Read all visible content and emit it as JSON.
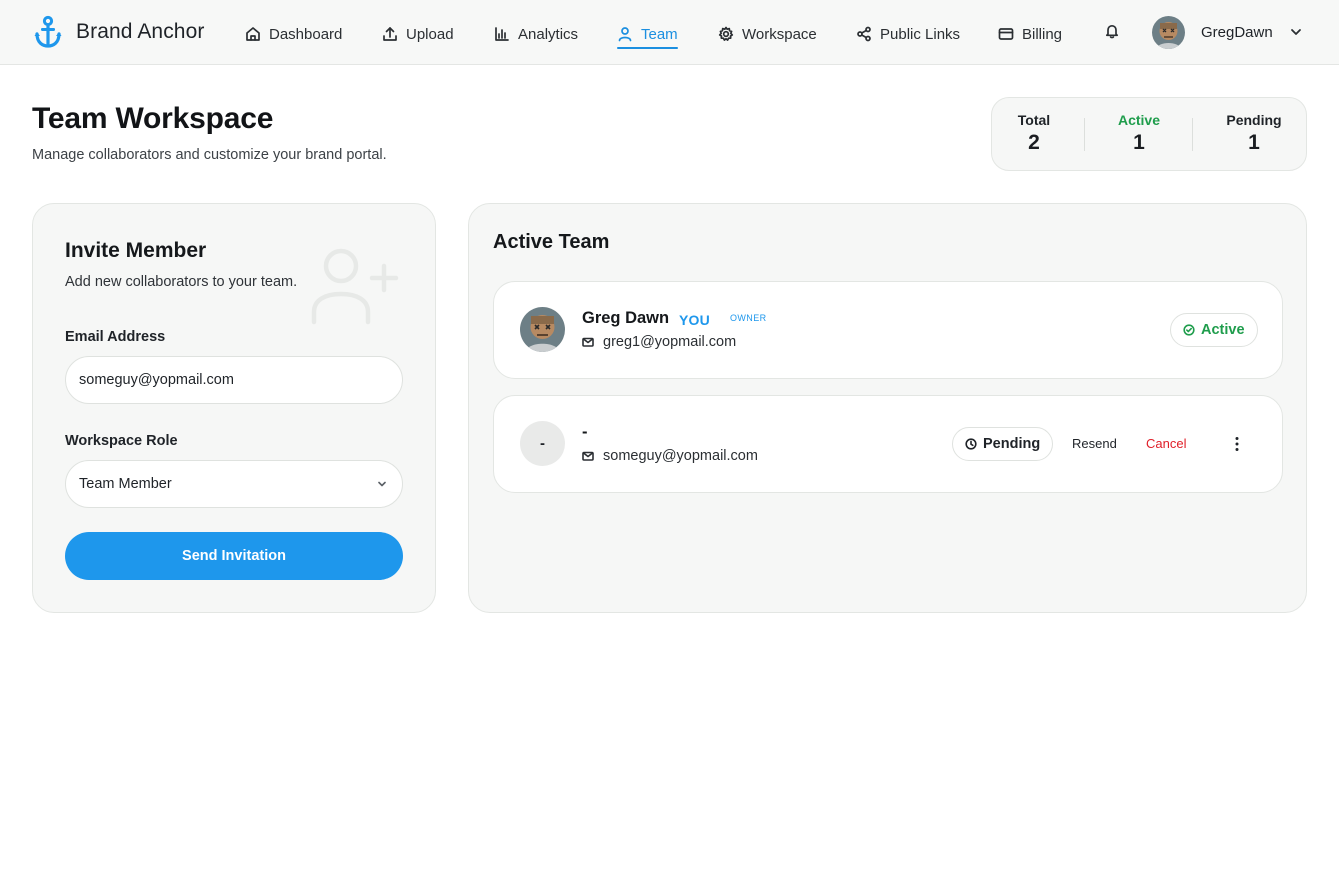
{
  "brand": {
    "name": "Brand Anchor",
    "accent": "#1e97ec"
  },
  "nav": {
    "items": [
      {
        "label": "Dashboard",
        "icon": "home-icon"
      },
      {
        "label": "Upload",
        "icon": "upload-icon"
      },
      {
        "label": "Analytics",
        "icon": "bar-chart-icon"
      },
      {
        "label": "Team",
        "icon": "user-icon",
        "active": true
      },
      {
        "label": "Workspace",
        "icon": "gear-icon"
      },
      {
        "label": "Public Links",
        "icon": "share-icon"
      },
      {
        "label": "Billing",
        "icon": "credit-card-icon"
      }
    ]
  },
  "user": {
    "name": "GregDawn"
  },
  "page": {
    "title": "Team Workspace",
    "subtitle": "Manage collaborators and customize your brand portal."
  },
  "stats": {
    "total_label": "Total",
    "total_value": "2",
    "active_label": "Active",
    "active_value": "1",
    "pending_label": "Pending",
    "pending_value": "1"
  },
  "invite": {
    "title": "Invite Member",
    "subtitle": "Add new collaborators to your team.",
    "email_label": "Email Address",
    "email_value": "someguy@yopmail.com",
    "role_label": "Workspace Role",
    "role_value": "Team Member",
    "send_label": "Send Invitation"
  },
  "team": {
    "title": "Active Team",
    "members": [
      {
        "name": "Greg Dawn",
        "you_badge": "YOU",
        "role_badge": "OWNER",
        "email": "greg1@yopmail.com",
        "status": "Active"
      },
      {
        "initial": "-",
        "name": "-",
        "email": "someguy@yopmail.com",
        "status": "Pending",
        "resend_label": "Resend",
        "cancel_label": "Cancel"
      }
    ]
  },
  "colors": {
    "active_status": "#1f9d4c",
    "cancel": "#e0202a"
  }
}
